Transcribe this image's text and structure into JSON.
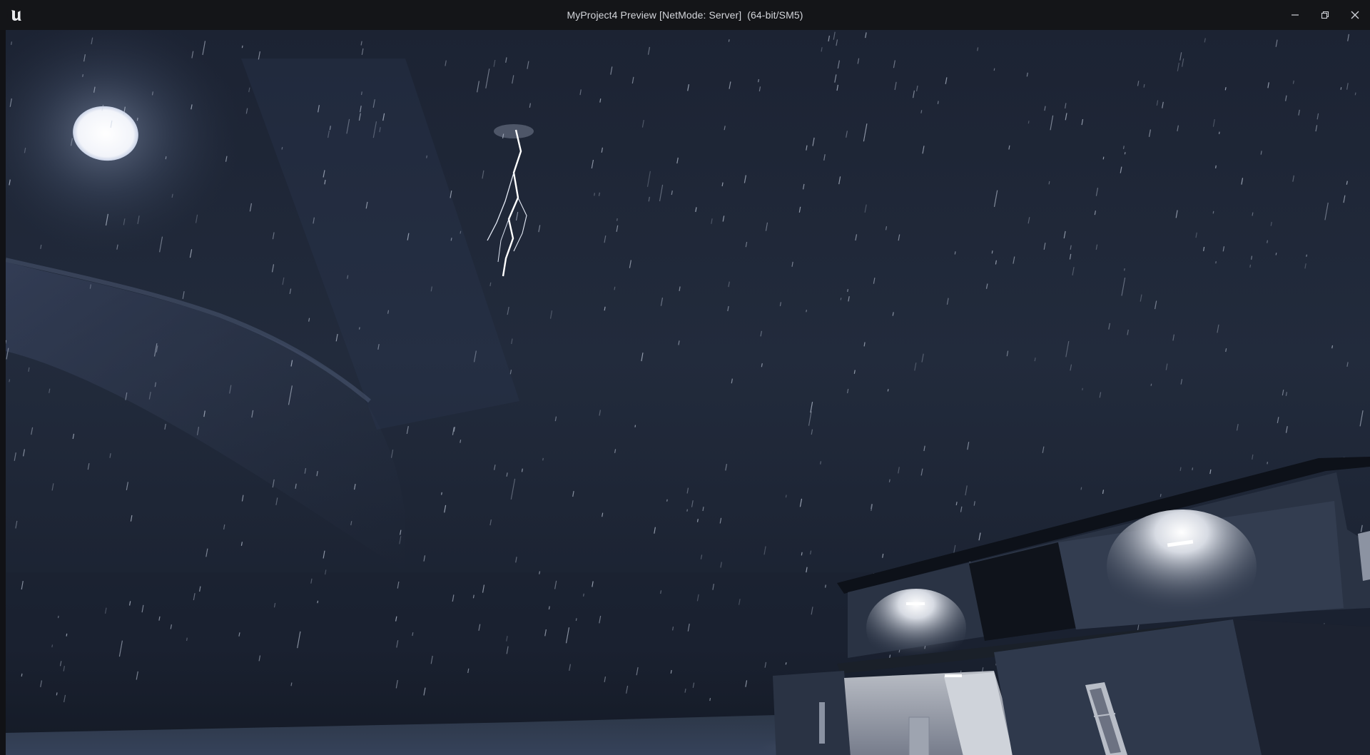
{
  "window": {
    "title": "MyProject4 Preview [NetMode: Server]  (64-bit/SM5)",
    "logo_icon": "unreal-engine-logo-icon",
    "controls": [
      {
        "name": "minimize-button",
        "icon": "minimize-icon"
      },
      {
        "name": "restore-button",
        "icon": "restore-icon"
      },
      {
        "name": "close-button",
        "icon": "close-icon"
      }
    ]
  },
  "scene": {
    "description_icons": [
      "moon",
      "lightning-bolt",
      "clouds",
      "rain",
      "house",
      "ground"
    ],
    "colors": {
      "sky_top": "#1b2232",
      "sky_mid": "#222a3b",
      "sky_bottom": "#151b28",
      "moon": "#f4f6fb",
      "house_wall": "#2b3445",
      "house_lit": "#8e96a6",
      "ground": "#2a3446"
    }
  }
}
